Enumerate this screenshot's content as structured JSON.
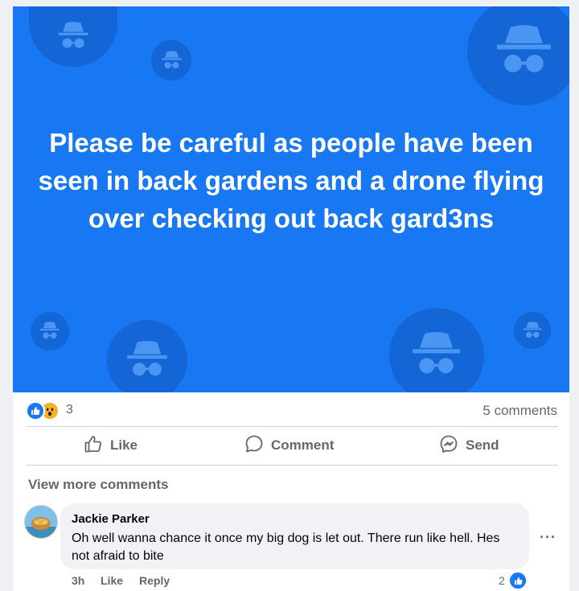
{
  "post": {
    "text": "Please be careful as people have been seen in back gardens and a drone flying over checking out back gard3ns",
    "background_color": "#1877f2",
    "decor_icon": "incognito-icon"
  },
  "stats": {
    "reactions": [
      "like-reaction-icon",
      "wow-reaction-icon"
    ],
    "reaction_count": "3",
    "comments_label": "5 comments"
  },
  "actions": {
    "like": "Like",
    "comment": "Comment",
    "send": "Send"
  },
  "comments_section": {
    "view_more": "View more comments",
    "comments": [
      {
        "author": "Jackie Parker",
        "text": "Oh well wanna chance it once my big dog is let out. There run like hell. Hes not afraid to bite",
        "time": "3h",
        "like_label": "Like",
        "reply_label": "Reply",
        "like_count": "2"
      }
    ]
  }
}
